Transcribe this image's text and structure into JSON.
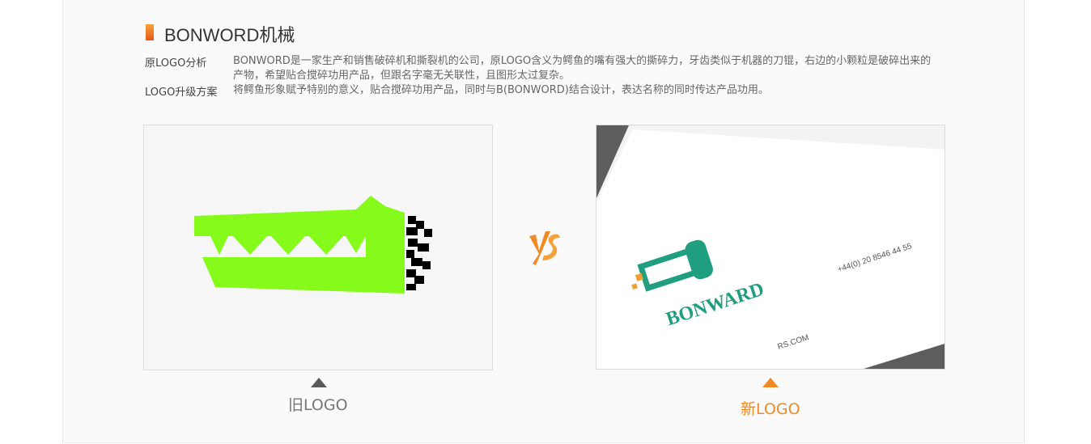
{
  "header": {
    "title": "BONWORD机械",
    "accent_color": "#f08a24"
  },
  "info": {
    "original_label": "原LOGO分析",
    "original_text_line1": "BONWORD是一家生产和销售破碎机和撕裂机的公司，原LOGO含义为鳄鱼的嘴有强大的撕碎力，牙齿类似于机器的刀锟，右边的小颗粒是破碎出来的",
    "original_text_line2": "产物，希望贴合搅碎功用产品，但跟名字毫无关联性，且图形太过复杂。",
    "upgrade_label": "LOGO升级方案",
    "upgrade_text": "将鳄鱼形象赋予特别的意义，贴合搅碎功用产品，同时与B(BONWORD)结合设计，表达名称的同时传达产品功用。"
  },
  "comparison": {
    "old_caption": "旧LOGO",
    "new_caption": "新LOGO",
    "vs_icon": "vs-icon",
    "old_logo_color": "#86fb1b",
    "new_logo_color": "#1f9e80"
  },
  "card": {
    "brand": "BONWARD",
    "phone": "+44(0) 20 8546 44 55",
    "web": "RS.COM"
  }
}
